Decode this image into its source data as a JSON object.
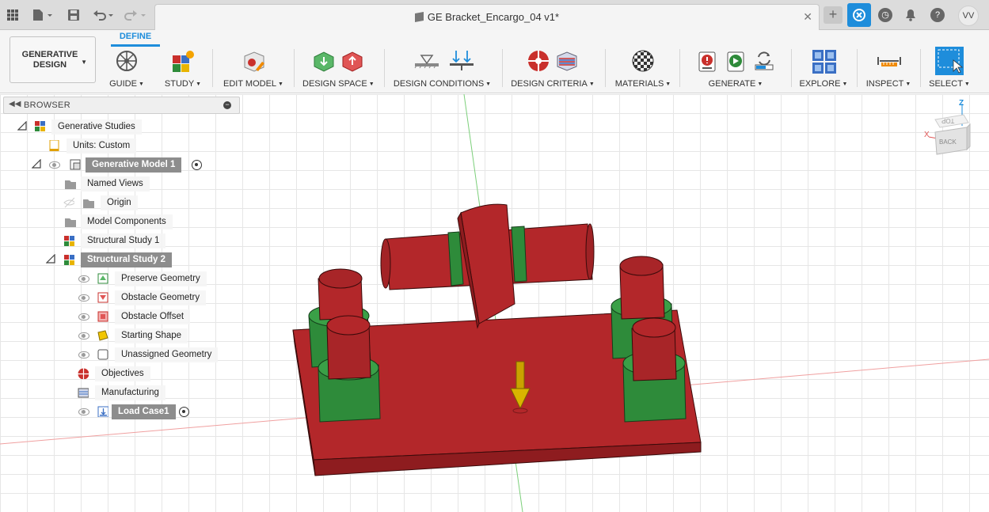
{
  "titlebar": {
    "document_title": "GE Bracket_Encargo_04 v1*",
    "user_initials": "VV"
  },
  "toolbar": {
    "workspace": "GENERATIVE\nDESIGN",
    "workspace_line1": "GENERATIVE",
    "workspace_line2": "DESIGN",
    "active_tab": "DEFINE",
    "groups": [
      {
        "label": "GUIDE"
      },
      {
        "label": "STUDY"
      },
      {
        "label": "EDIT MODEL"
      },
      {
        "label": "DESIGN SPACE"
      },
      {
        "label": "DESIGN CONDITIONS"
      },
      {
        "label": "DESIGN CRITERIA"
      },
      {
        "label": "MATERIALS"
      },
      {
        "label": "GENERATE"
      },
      {
        "label": "EXPLORE"
      },
      {
        "label": "INSPECT"
      },
      {
        "label": "SELECT"
      }
    ]
  },
  "browser": {
    "title": "BROWSER",
    "items": [
      {
        "label": "Generative Studies"
      },
      {
        "label": "Units: Custom"
      },
      {
        "label": "Generative Model 1"
      },
      {
        "label": "Named Views"
      },
      {
        "label": "Origin"
      },
      {
        "label": "Model Components"
      },
      {
        "label": "Structural Study 1"
      },
      {
        "label": "Structural Study 2"
      },
      {
        "label": "Preserve Geometry"
      },
      {
        "label": "Obstacle Geometry"
      },
      {
        "label": "Obstacle Offset"
      },
      {
        "label": "Starting Shape"
      },
      {
        "label": "Unassigned Geometry"
      },
      {
        "label": "Objectives"
      },
      {
        "label": "Manufacturing"
      },
      {
        "label": "Load Case1"
      }
    ]
  },
  "viewcube": {
    "face_label": "BACK",
    "top_label": "TOP",
    "axis_z": "Z",
    "axis_x": "X"
  },
  "colors": {
    "accent": "#1e8ddb",
    "obstacle_red": "#b3272a",
    "preserve_green": "#2e8b3a",
    "load_arrow": "#c9a200"
  }
}
